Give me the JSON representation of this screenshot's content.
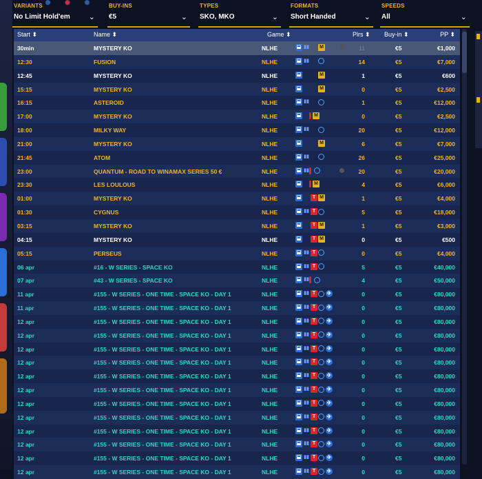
{
  "filters": [
    {
      "label": "VARIANTS",
      "value": "No Limit Hold'em"
    },
    {
      "label": "BUY-INS",
      "value": "€5"
    },
    {
      "label": "TYPES",
      "value": "SKO, MKO"
    },
    {
      "label": "FORMATS",
      "value": "Short Handed"
    },
    {
      "label": "SPEEDS",
      "value": "All"
    }
  ],
  "columns": {
    "start": "Start ⬍",
    "name": "Name ⬍",
    "game": "Game ⬍",
    "players": "Plrs ⬍",
    "buyin": "Buy-in ⬍",
    "pp": "PP ⬍"
  },
  "rows": [
    {
      "start": "30min",
      "name": "MYSTERY KO",
      "game": "NLHE",
      "plrs": "11",
      "buyin": "€5",
      "pp": "€1,000",
      "color": "white",
      "icons": [
        "b",
        "bar",
        "m"
      ],
      "extra": true,
      "selected": true,
      "dim_plrs": true
    },
    {
      "start": "12:30",
      "name": "FUSION",
      "game": "NLHE",
      "plrs": "14",
      "buyin": "€5",
      "pp": "€7,000",
      "color": "gold",
      "icons": [
        "b",
        "bar",
        "o"
      ]
    },
    {
      "start": "12:45",
      "name": "MYSTERY KO",
      "game": "NLHE",
      "plrs": "1",
      "buyin": "€5",
      "pp": "€600",
      "color": "white",
      "icons": [
        "b",
        "m"
      ]
    },
    {
      "start": "15:15",
      "name": "MYSTERY KO",
      "game": "NLHE",
      "plrs": "0",
      "buyin": "€5",
      "pp": "€2,500",
      "color": "gold",
      "icons": [
        "b",
        "m"
      ]
    },
    {
      "start": "16:15",
      "name": "ASTEROID",
      "game": "NLHE",
      "plrs": "1",
      "buyin": "€5",
      "pp": "€12,000",
      "color": "gold",
      "icons": [
        "b",
        "bar",
        "o"
      ]
    },
    {
      "start": "17:00",
      "name": "MYSTERY KO",
      "game": "NLHE",
      "plrs": "0",
      "buyin": "€5",
      "pp": "€2,500",
      "color": "gold",
      "icons": [
        "b",
        "f",
        "m"
      ]
    },
    {
      "start": "18:00",
      "name": "MILKY WAY",
      "game": "NLHE",
      "plrs": "20",
      "buyin": "€5",
      "pp": "€12,000",
      "color": "gold",
      "icons": [
        "b",
        "bar",
        "o"
      ]
    },
    {
      "start": "21:00",
      "name": "MYSTERY KO",
      "game": "NLHE",
      "plrs": "6",
      "buyin": "€5",
      "pp": "€7,000",
      "color": "gold",
      "icons": [
        "b",
        "m"
      ]
    },
    {
      "start": "21:45",
      "name": "ATOM",
      "game": "NLHE",
      "plrs": "26",
      "buyin": "€5",
      "pp": "€25,000",
      "color": "gold",
      "icons": [
        "b",
        "bar",
        "o"
      ]
    },
    {
      "start": "23:00",
      "name": "QUANTUM - ROAD TO WINAMAX SERIES 50 €",
      "game": "NLHE",
      "plrs": "20",
      "buyin": "€5",
      "pp": "€20,000",
      "color": "gold",
      "icons": [
        "b",
        "bar",
        "f",
        "o"
      ],
      "extra": true
    },
    {
      "start": "23:30",
      "name": "LES LOULOUS",
      "game": "NLHE",
      "plrs": "4",
      "buyin": "€5",
      "pp": "€6,000",
      "color": "gold",
      "icons": [
        "b",
        "f",
        "m"
      ]
    },
    {
      "start": "01:00",
      "name": "MYSTERY KO",
      "game": "NLHE",
      "plrs": "1",
      "buyin": "€5",
      "pp": "€4,000",
      "color": "gold",
      "icons": [
        "b",
        "t",
        "m"
      ]
    },
    {
      "start": "01:30",
      "name": "CYGNUS",
      "game": "NLHE",
      "plrs": "5",
      "buyin": "€5",
      "pp": "€18,000",
      "color": "gold",
      "icons": [
        "b",
        "bar",
        "t",
        "o"
      ]
    },
    {
      "start": "03:15",
      "name": "MYSTERY KO",
      "game": "NLHE",
      "plrs": "1",
      "buyin": "€5",
      "pp": "€3,000",
      "color": "gold",
      "icons": [
        "b",
        "t",
        "m"
      ]
    },
    {
      "start": "04:15",
      "name": "MYSTERY KO",
      "game": "NLHE",
      "plrs": "0",
      "buyin": "€5",
      "pp": "€500",
      "color": "white",
      "icons": [
        "b",
        "t",
        "m"
      ]
    },
    {
      "start": "05:15",
      "name": "PERSEUS",
      "game": "NLHE",
      "plrs": "0",
      "buyin": "€5",
      "pp": "€4,000",
      "color": "gold",
      "icons": [
        "b",
        "bar",
        "t",
        "o"
      ]
    },
    {
      "start": "06 apr",
      "name": "#16 - W SERIES - SPACE KO",
      "game": "NLHE",
      "plrs": "5",
      "buyin": "€5",
      "pp": "€40,000",
      "color": "cyan",
      "icons": [
        "b",
        "bar",
        "t",
        "o"
      ]
    },
    {
      "start": "07 apr",
      "name": "#43 - W SERIES - SPACE KO",
      "game": "NLHE",
      "plrs": "4",
      "buyin": "€5",
      "pp": "€50,000",
      "color": "cyan",
      "icons": [
        "b",
        "bar",
        "f",
        "o"
      ]
    },
    {
      "start": "11 apr",
      "name": "#155 - W SERIES - ONE TIME - SPACE KO - DAY 1",
      "game": "NLHE",
      "plrs": "0",
      "buyin": "€5",
      "pp": "€80,000",
      "color": "cyan",
      "icons": [
        "b",
        "bar",
        "t",
        "o",
        "p"
      ]
    },
    {
      "start": "11 apr",
      "name": "#155 - W SERIES - ONE TIME - SPACE KO - DAY 1",
      "game": "NLHE",
      "plrs": "0",
      "buyin": "€5",
      "pp": "€80,000",
      "color": "cyan",
      "icons": [
        "b",
        "bar",
        "t",
        "o",
        "p"
      ]
    },
    {
      "start": "12 apr",
      "name": "#155 - W SERIES - ONE TIME - SPACE KO - DAY 1",
      "game": "NLHE",
      "plrs": "0",
      "buyin": "€5",
      "pp": "€80,000",
      "color": "cyan",
      "icons": [
        "b",
        "bar",
        "t",
        "o",
        "p"
      ]
    },
    {
      "start": "12 apr",
      "name": "#155 - W SERIES - ONE TIME - SPACE KO - DAY 1",
      "game": "NLHE",
      "plrs": "0",
      "buyin": "€5",
      "pp": "€80,000",
      "color": "cyan",
      "icons": [
        "b",
        "bar",
        "t",
        "o",
        "p"
      ]
    },
    {
      "start": "12 apr",
      "name": "#155 - W SERIES - ONE TIME - SPACE KO - DAY 1",
      "game": "NLHE",
      "plrs": "0",
      "buyin": "€5",
      "pp": "€80,000",
      "color": "cyan",
      "icons": [
        "b",
        "bar",
        "t",
        "o",
        "p"
      ]
    },
    {
      "start": "12 apr",
      "name": "#155 - W SERIES - ONE TIME - SPACE KO - DAY 1",
      "game": "NLHE",
      "plrs": "0",
      "buyin": "€5",
      "pp": "€80,000",
      "color": "cyan",
      "icons": [
        "b",
        "bar",
        "t",
        "o",
        "p"
      ]
    },
    {
      "start": "12 apr",
      "name": "#155 - W SERIES - ONE TIME - SPACE KO - DAY 1",
      "game": "NLHE",
      "plrs": "0",
      "buyin": "€5",
      "pp": "€80,000",
      "color": "cyan",
      "icons": [
        "b",
        "bar",
        "t",
        "o",
        "p"
      ]
    },
    {
      "start": "12 apr",
      "name": "#155 - W SERIES - ONE TIME - SPACE KO - DAY 1",
      "game": "NLHE",
      "plrs": "0",
      "buyin": "€5",
      "pp": "€80,000",
      "color": "cyan",
      "icons": [
        "b",
        "bar",
        "t",
        "o",
        "p"
      ]
    },
    {
      "start": "12 apr",
      "name": "#155 - W SERIES - ONE TIME - SPACE KO - DAY 1",
      "game": "NLHE",
      "plrs": "0",
      "buyin": "€5",
      "pp": "€80,000",
      "color": "cyan",
      "icons": [
        "b",
        "bar",
        "t",
        "o",
        "p"
      ]
    },
    {
      "start": "12 apr",
      "name": "#155 - W SERIES - ONE TIME - SPACE KO - DAY 1",
      "game": "NLHE",
      "plrs": "0",
      "buyin": "€5",
      "pp": "€80,000",
      "color": "cyan",
      "icons": [
        "b",
        "bar",
        "t",
        "o",
        "p"
      ]
    },
    {
      "start": "12 apr",
      "name": "#155 - W SERIES - ONE TIME - SPACE KO - DAY 1",
      "game": "NLHE",
      "plrs": "0",
      "buyin": "€5",
      "pp": "€80,000",
      "color": "cyan",
      "icons": [
        "b",
        "bar",
        "t",
        "o",
        "p"
      ]
    },
    {
      "start": "12 apr",
      "name": "#155 - W SERIES - ONE TIME - SPACE KO - DAY 1",
      "game": "NLHE",
      "plrs": "0",
      "buyin": "€5",
      "pp": "€80,000",
      "color": "cyan",
      "icons": [
        "b",
        "bar",
        "t",
        "o",
        "p"
      ]
    },
    {
      "start": "12 apr",
      "name": "#155 - W SERIES - ONE TIME - SPACE KO - DAY 1",
      "game": "NLHE",
      "plrs": "0",
      "buyin": "€5",
      "pp": "€80,000",
      "color": "cyan",
      "icons": [
        "b",
        "bar",
        "t",
        "o",
        "p"
      ]
    },
    {
      "start": "12 apr",
      "name": "#155 - W SERIES - ONE TIME - SPACE KO - DAY 1",
      "game": "NLHE",
      "plrs": "0",
      "buyin": "€5",
      "pp": "€80,000",
      "color": "cyan",
      "icons": [
        "b",
        "bar",
        "t",
        "o",
        "p"
      ]
    }
  ],
  "icon_names": {
    "b": "blind-icon",
    "bar": "speed-bars-icon",
    "m": "mystery-icon",
    "t": "ticket-icon",
    "o": "ko-orbit-icon",
    "p": "plane-icon",
    "f": "flag-icon"
  },
  "colors": {
    "accent": "#f2b320",
    "header": "#2a3f7a",
    "cyan_text": "#29d7c0"
  }
}
